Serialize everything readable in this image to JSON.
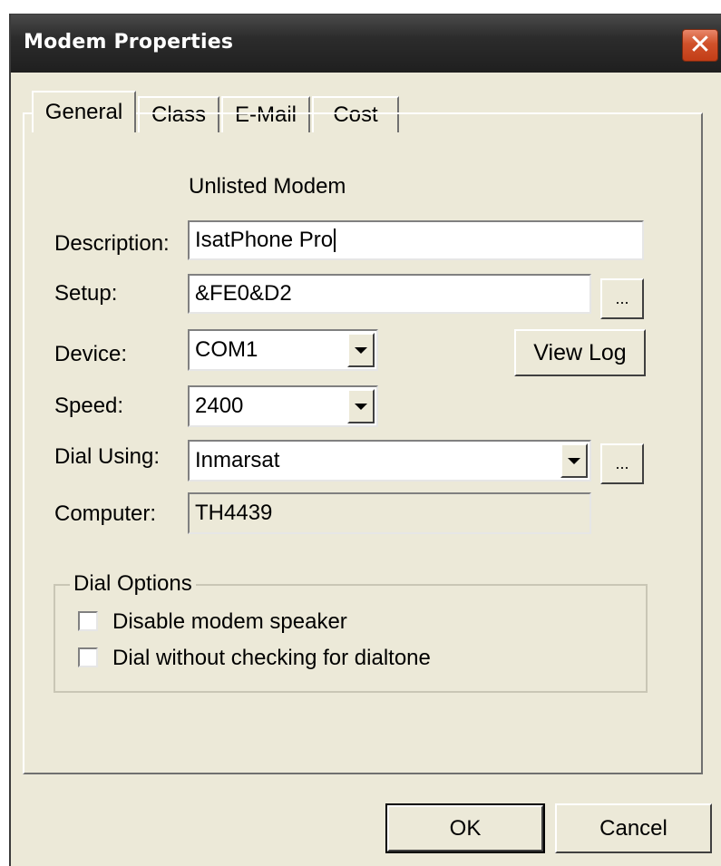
{
  "window": {
    "title": "Modem Properties",
    "close_icon": "close-icon",
    "close_glyph": "✕"
  },
  "tabs": [
    {
      "label": "General",
      "active": true
    },
    {
      "label": "Class",
      "active": false
    },
    {
      "label": "E-Mail",
      "active": false
    },
    {
      "label": "Cost",
      "active": false
    }
  ],
  "general": {
    "modem_type": "Unlisted Modem",
    "description": {
      "label": "Description:",
      "value": "IsatPhone Pro"
    },
    "setup": {
      "label": "Setup:",
      "value": "&FE0&D2",
      "browse_label": "..."
    },
    "device": {
      "label": "Device:",
      "value": "COM1"
    },
    "view_log_label": "View Log",
    "speed": {
      "label": "Speed:",
      "value": "2400"
    },
    "dial_using": {
      "label": "Dial Using:",
      "value": "Inmarsat",
      "browse_label": "..."
    },
    "computer": {
      "label": "Computer:",
      "value": "TH4439"
    }
  },
  "dial_options": {
    "title": "Dial Options",
    "options": [
      {
        "label": "Disable modem speaker",
        "checked": false
      },
      {
        "label": "Dial without checking for dialtone",
        "checked": false
      }
    ]
  },
  "footer": {
    "ok_label": "OK",
    "cancel_label": "Cancel"
  }
}
